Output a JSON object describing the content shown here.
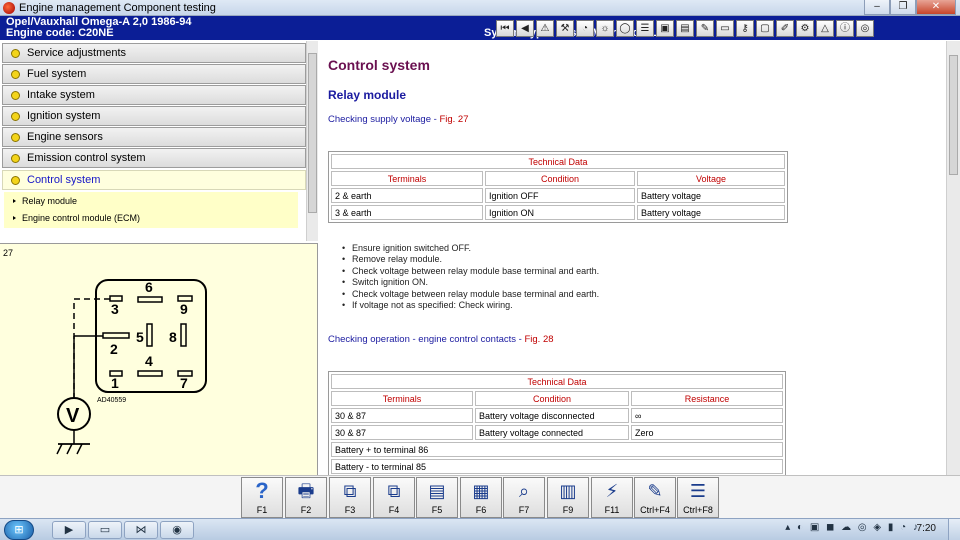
{
  "window": {
    "title": "Engine management Component testing",
    "buttons": {
      "minimize": "–",
      "maximize": "❐",
      "close": "✕"
    }
  },
  "header": {
    "vehicle": "Opel/Vauxhall   Omega-A  2,0  1986-94",
    "engine_code": "Engine code: C20NE",
    "system_type": "System type: Bosch Motronic ML4.1",
    "toolbar_icons": [
      "first-icon",
      "back-icon",
      "warning-icon",
      "tools-icon",
      "gauge-icon",
      "bulb-icon",
      "circle-icon",
      "list-icon",
      "car-icon",
      "document-icon",
      "brush-icon",
      "battery-icon",
      "key-icon",
      "screen-icon",
      "pencil-icon",
      "settings-icon",
      "alert-icon",
      "info-icon",
      "target-icon"
    ]
  },
  "nav": {
    "items": [
      {
        "label": "Service adjustments",
        "active": false
      },
      {
        "label": "Fuel system",
        "active": false
      },
      {
        "label": "Intake system",
        "active": false
      },
      {
        "label": "Ignition system",
        "active": false
      },
      {
        "label": "Engine sensors",
        "active": false
      },
      {
        "label": "Emission control system",
        "active": false
      },
      {
        "label": "Control system",
        "active": true
      }
    ],
    "subitems": [
      "Relay module",
      "Engine control module (ECM)"
    ]
  },
  "diagram": {
    "figure_number": "27",
    "pins": [
      "6",
      "3",
      "9",
      "5",
      "8",
      "2",
      "4",
      "1",
      "7"
    ],
    "meter_label": "V",
    "code": "AD40559"
  },
  "content": {
    "title": "Control system",
    "section": "Relay module",
    "check1": {
      "text": "Checking supply voltage",
      "sep": " - ",
      "fig": "Fig. 27"
    },
    "table1": {
      "caption": "Technical Data",
      "headers": [
        "Terminals",
        "Condition",
        "Voltage"
      ],
      "rows": [
        [
          "2 & earth",
          "Ignition OFF",
          "Battery voltage"
        ],
        [
          "3 & earth",
          "Ignition ON",
          "Battery voltage"
        ]
      ]
    },
    "steps": [
      "Ensure ignition switched OFF.",
      "Remove relay module.",
      "Check voltage between relay module base terminal and earth.",
      "Switch ignition ON.",
      "Check voltage between relay module base terminal and earth.",
      "If voltage not as specified: Check wiring."
    ],
    "check2": {
      "text": "Checking operation - engine control contacts",
      "sep": " - ",
      "fig": "Fig. 28"
    },
    "table2": {
      "caption": "Technical Data",
      "headers": [
        "Terminals",
        "Condition",
        "Resistance"
      ],
      "rows": [
        [
          "30 & 87",
          "Battery voltage disconnected",
          "∞"
        ],
        [
          "30 & 87",
          "Battery voltage connected",
          "Zero"
        ]
      ],
      "notes": [
        "Battery + to terminal 86",
        "Battery - to terminal 85"
      ]
    }
  },
  "fkeys": [
    {
      "label": "F1",
      "icon": "help-icon"
    },
    {
      "label": "F2",
      "icon": "print-icon"
    },
    {
      "label": "F3",
      "icon": "copy-icon"
    },
    {
      "label": "F4",
      "icon": "paste-icon"
    },
    {
      "label": "F5",
      "icon": "page-icon"
    },
    {
      "label": "F6",
      "icon": "diagram-icon"
    },
    {
      "label": "F7",
      "icon": "zoom-icon"
    },
    {
      "label": "F9",
      "icon": "pages-icon"
    },
    {
      "label": "F11",
      "icon": "probe-icon"
    },
    {
      "label": "Ctrl+F4",
      "icon": "edit-icon"
    },
    {
      "label": "Ctrl+F8",
      "icon": "table-icon"
    }
  ],
  "taskbar": {
    "start": "⊞",
    "apps": [
      "▶",
      "▭",
      "⋈",
      "◉"
    ],
    "clock": "7:20"
  }
}
